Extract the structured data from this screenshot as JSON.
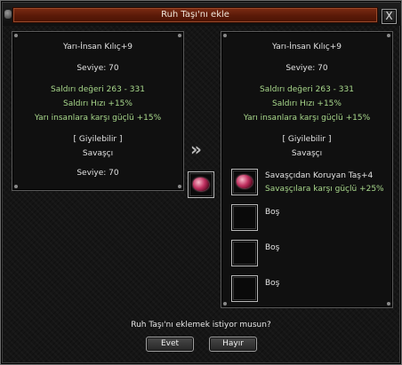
{
  "window": {
    "title": "Ruh Taşı'nı ekle",
    "close_label": "X"
  },
  "left_panel": {
    "item_name": "Yarı-İnsan Kılıç+9",
    "level": "Seviye: 70",
    "attack_value": "Saldırı değeri 263 - 331",
    "attack_speed": "Saldırı Hızı +15%",
    "bonus": "Yarı insanlara karşı güçlü +15%",
    "wearable": "[ Giyilebilir ]",
    "class": "Savaşçı",
    "required_level": "Seviye: 70"
  },
  "right_panel": {
    "item_name": "Yarı-İnsan Kılıç+9",
    "level": "Seviye: 70",
    "attack_value": "Saldırı değeri 263 - 331",
    "attack_speed": "Saldırı Hızı +15%",
    "bonus": "Yarı insanlara karşı güçlü +15%",
    "wearable": "[ Giyilebilir ]",
    "class": "Savaşçı",
    "slots": [
      {
        "name": "Savaşçıdan Koruyan Taş+4",
        "bonus": "Savaşçılara karşı güçlü +25%",
        "icon": "soul-stone-icon"
      },
      {
        "name": "Boş",
        "icon": "empty-slot"
      },
      {
        "name": "Boş",
        "icon": "empty-slot"
      },
      {
        "name": "Boş",
        "icon": "empty-slot"
      }
    ]
  },
  "arrow_glyph": "»",
  "source_slot_icon": "soul-stone-icon",
  "prompt": {
    "question": "Ruh Taşı'nı eklemek istiyor musun?",
    "yes_label": "Evet",
    "no_label": "Hayır"
  },
  "colors": {
    "title_bar": "#5a1a08",
    "bonus_text": "#a9d98c",
    "text": "#e2e2e2"
  }
}
